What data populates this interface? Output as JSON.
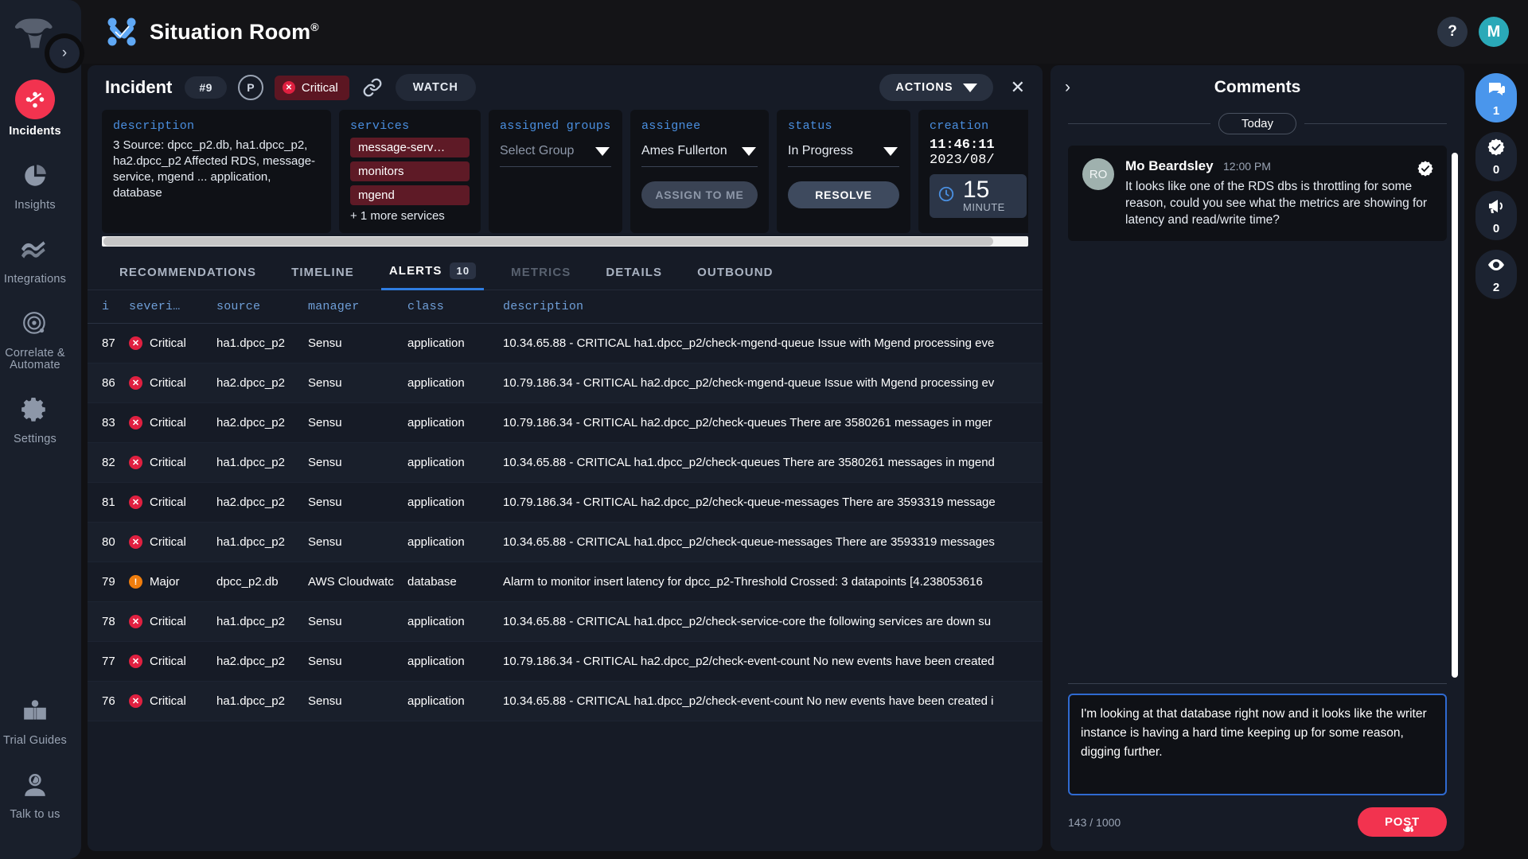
{
  "sidebar": {
    "expand_icon": "chevron-right-icon",
    "items": [
      {
        "label": "Incidents",
        "icon": "incidents-icon",
        "active": true
      },
      {
        "label": "Insights",
        "icon": "pie-chart-icon",
        "active": false
      },
      {
        "label": "Integrations",
        "icon": "integrations-icon",
        "active": false
      },
      {
        "label": "Correlate & Automate",
        "icon": "radar-icon",
        "active": false
      },
      {
        "label": "Settings",
        "icon": "gear-icon",
        "active": false
      }
    ],
    "bottom_items": [
      {
        "label": "Trial Guides",
        "icon": "book-icon"
      },
      {
        "label": "Talk to us",
        "icon": "support-agent-icon"
      }
    ]
  },
  "header": {
    "title": "Situation Room",
    "title_mark": "®",
    "logo_icon": "situation-room-logo-icon",
    "help_label": "?",
    "avatar_initial": "M"
  },
  "incident": {
    "title": "Incident",
    "number": "#9",
    "priority": "P",
    "severity": "Critical",
    "severity_color": "#e02040",
    "link_icon": "link-icon",
    "watch_label": "WATCH",
    "actions_label": "ACTIONS",
    "close_icon": "close-icon"
  },
  "cards": {
    "description": {
      "label": "description",
      "text": "3 Source: dpcc_p2.db, ha1.dpcc_p2, ha2.dpcc_p2 Affected RDS, message-service, mgend ... application, database"
    },
    "services": {
      "label": "services",
      "chips": [
        "message-serv…",
        "monitors",
        "mgend"
      ],
      "more": "+ 1 more services"
    },
    "assigned_groups": {
      "label": "assigned groups",
      "placeholder": "Select Group",
      "value": ""
    },
    "assignee": {
      "label": "assignee",
      "value": "Ames Fullerton",
      "button": "ASSIGN TO ME"
    },
    "status": {
      "label": "status",
      "value": "In Progress",
      "button": "RESOLVE"
    },
    "creation": {
      "label": "creation",
      "time": "11:46:11",
      "date": "2023/08/",
      "age_number": "15",
      "age_unit": "MINUTE",
      "clock_icon": "clock-icon"
    }
  },
  "tabs": [
    {
      "label": "RECOMMENDATIONS",
      "state": "normal"
    },
    {
      "label": "TIMELINE",
      "state": "normal"
    },
    {
      "label": "ALERTS",
      "state": "active",
      "count": "10"
    },
    {
      "label": "METRICS",
      "state": "disabled"
    },
    {
      "label": "DETAILS",
      "state": "normal"
    },
    {
      "label": "OUTBOUND",
      "state": "normal"
    }
  ],
  "alerts_table": {
    "columns": [
      "i",
      "severi…",
      "source",
      "manager",
      "class",
      "description"
    ],
    "rows": [
      {
        "i": "87",
        "severity": "Critical",
        "source": "ha1.dpcc_p2",
        "manager": "Sensu",
        "class": "application",
        "description": "10.34.65.88 - CRITICAL ha1.dpcc_p2/check-mgend-queue Issue with Mgend processing eve"
      },
      {
        "i": "86",
        "severity": "Critical",
        "source": "ha2.dpcc_p2",
        "manager": "Sensu",
        "class": "application",
        "description": "10.79.186.34 - CRITICAL ha2.dpcc_p2/check-mgend-queue Issue with Mgend processing ev"
      },
      {
        "i": "83",
        "severity": "Critical",
        "source": "ha2.dpcc_p2",
        "manager": "Sensu",
        "class": "application",
        "description": "10.79.186.34 - CRITICAL ha2.dpcc_p2/check-queues There are 3580261 messages in mger"
      },
      {
        "i": "82",
        "severity": "Critical",
        "source": "ha1.dpcc_p2",
        "manager": "Sensu",
        "class": "application",
        "description": "10.34.65.88 - CRITICAL ha1.dpcc_p2/check-queues There are 3580261 messages in mgend"
      },
      {
        "i": "81",
        "severity": "Critical",
        "source": "ha2.dpcc_p2",
        "manager": "Sensu",
        "class": "application",
        "description": "10.79.186.34 - CRITICAL ha2.dpcc_p2/check-queue-messages There are 3593319 message"
      },
      {
        "i": "80",
        "severity": "Critical",
        "source": "ha1.dpcc_p2",
        "manager": "Sensu",
        "class": "application",
        "description": "10.34.65.88 - CRITICAL ha1.dpcc_p2/check-queue-messages There are 3593319 messages"
      },
      {
        "i": "79",
        "severity": "Major",
        "source": "dpcc_p2.db",
        "manager": "AWS Cloudwatc",
        "class": "database",
        "description": "Alarm to monitor insert latency for dpcc_p2-Threshold Crossed: 3 datapoints [4.238053616"
      },
      {
        "i": "78",
        "severity": "Critical",
        "source": "ha1.dpcc_p2",
        "manager": "Sensu",
        "class": "application",
        "description": "10.34.65.88 - CRITICAL ha1.dpcc_p2/check-service-core the following services are down su"
      },
      {
        "i": "77",
        "severity": "Critical",
        "source": "ha2.dpcc_p2",
        "manager": "Sensu",
        "class": "application",
        "description": "10.79.186.34 - CRITICAL ha2.dpcc_p2/check-event-count No new events have been created"
      },
      {
        "i": "76",
        "severity": "Critical",
        "source": "ha1.dpcc_p2",
        "manager": "Sensu",
        "class": "application",
        "description": "10.34.65.88 - CRITICAL ha1.dpcc_p2/check-event-count No new events have been created i"
      }
    ]
  },
  "comments": {
    "title": "Comments",
    "collapse_icon": "chevron-right-icon",
    "day_separator": "Today",
    "items": [
      {
        "avatar": "RO",
        "author": "Mo Beardsley",
        "time": "12:00 PM",
        "text": "It looks like one of the RDS dbs is throttling for some reason, could you see what the metrics are showing for latency and read/write time?",
        "verified_icon": "verified-check-icon"
      }
    ],
    "compose": {
      "value": "I'm looking at that database right now and it looks like the writer instance is having a hard time keeping up for some reason, digging further.",
      "placeholder": "",
      "char_count": "143 / 1000",
      "post_label": "POST",
      "post_color": "#f2334f"
    }
  },
  "right_rail": [
    {
      "icon": "comments-icon",
      "count": "1",
      "active": true
    },
    {
      "icon": "verified-icon",
      "count": "0",
      "active": false
    },
    {
      "icon": "megaphone-icon",
      "count": "0",
      "active": false
    },
    {
      "icon": "eye-icon",
      "count": "2",
      "active": false
    }
  ]
}
